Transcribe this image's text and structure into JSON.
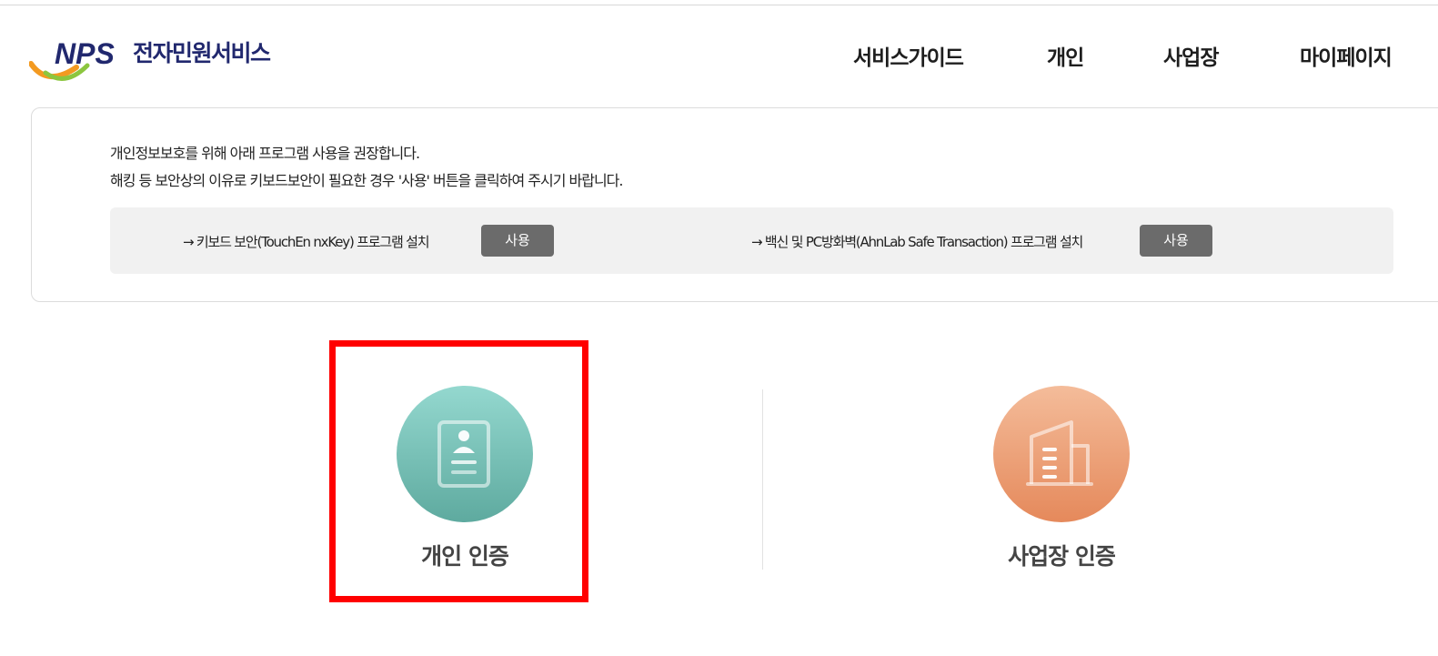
{
  "header": {
    "logo_text": "NPS",
    "logo_subtitle": "전자민원서비스",
    "nav": [
      {
        "label": "서비스가이드"
      },
      {
        "label": "개인"
      },
      {
        "label": "사업장"
      },
      {
        "label": "마이페이지"
      }
    ]
  },
  "notice": {
    "line1": "개인정보보호를 위해 아래 프로그램 사용을 권장합니다.",
    "line2": "해킹 등 보안상의 이유로 키보드보안이 필요한 경우 '사용' 버튼을 클릭하여 주시기 바랍니다.",
    "installs": [
      {
        "text": "→ 키보드 보안(TouchEn nxKey) 프로그램 설치",
        "button": "사용"
      },
      {
        "text": "→ 백신 및 PC방화벽(AhnLab Safe Transaction) 프로그램 설치",
        "button": "사용"
      }
    ]
  },
  "auth": {
    "personal": {
      "label": "개인 인증",
      "icon": "id-card-icon"
    },
    "business": {
      "label": "사업장 인증",
      "icon": "building-icon"
    }
  },
  "colors": {
    "brand_navy": "#21286e",
    "personal_gradient": [
      "#94d8cf",
      "#5eaa9f"
    ],
    "business_gradient": [
      "#f4bc9a",
      "#e5895b"
    ],
    "highlight": "#ff0000",
    "button_gray": "#6b6b6b"
  }
}
